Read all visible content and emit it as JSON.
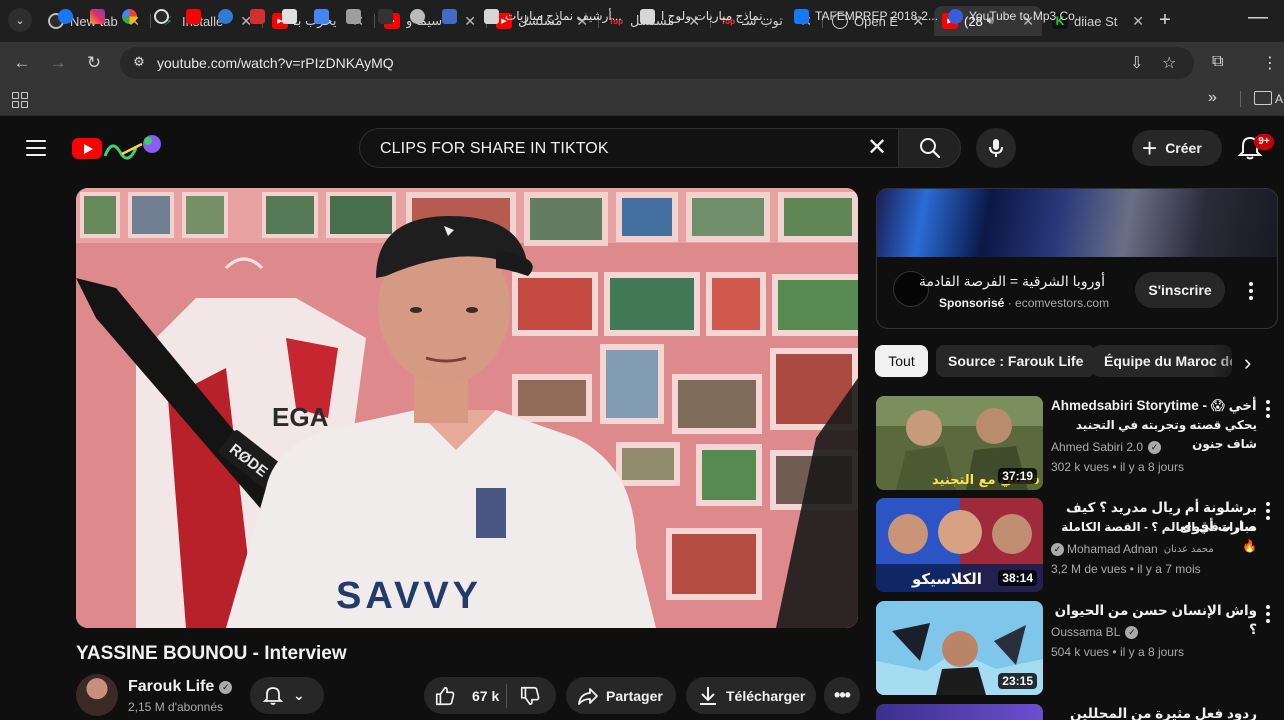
{
  "browser": {
    "tabs": [
      {
        "title": "New tab",
        "favicon": "chrome-icon",
        "color": "#444444"
      },
      {
        "title": "Installe",
        "favicon": "bolt-icon",
        "color": "#1aa260"
      },
      {
        "title": "يخرب بـ",
        "favicon": "youtube-icon",
        "color": "#ff0000"
      },
      {
        "title": "سيما و",
        "favicon": "youtube-icon",
        "color": "#ff0000"
      },
      {
        "title": "مسلسل",
        "favicon": "youtube-icon",
        "color": "#ff0000"
      },
      {
        "title": "مسلسل",
        "favicon": "toptop-icon",
        "color": "#ff0000"
      },
      {
        "title": "توب سـ",
        "favicon": "toptop-icon",
        "color": "#ff0000"
      },
      {
        "title": "Open E",
        "favicon": "openai-icon",
        "color": "#555555"
      },
      {
        "title": "(28",
        "favicon": "youtube-icon",
        "color": "#ff0000"
      },
      {
        "title": "diiae St",
        "favicon": "k-icon",
        "color": "#27c93f"
      }
    ],
    "url": "youtube.com/watch?v=rPIzDNKAyMQ",
    "bookmarks": [
      {
        "label": "أرشيف نماذج مباريات...",
        "color": "#c0c0c0"
      },
      {
        "label": "نماذج مباريات ولوج ا...",
        "color": "#c0c0c0"
      },
      {
        "label": "TAFEMPREP 2018-2...",
        "color": "#1877f2"
      },
      {
        "label": "YouTube to Mp3 Co...",
        "color": "#3b5bdb"
      }
    ]
  },
  "youtube": {
    "search_query": "CLIPS FOR SHARE IN TIKTOK",
    "create_label": "Créer",
    "notifications_badge": "9+",
    "video": {
      "title": "YASSINE BOUNOU - Interview",
      "channel": "Farouk Life",
      "subscribers": "2,15 M d'abonnés",
      "likes": "67 k",
      "share_label": "Partager",
      "download_label": "Télécharger",
      "shirt_text": "SAVVY",
      "jersey_text": "EGA",
      "mic_brand": "RØDE"
    },
    "ad": {
      "title": "أوروبا الشرقية = الفرصة القادمة",
      "sponsored": "Sponsorisé",
      "domain": "ecomvestors.com",
      "subscribe_label": "S'inscrire"
    },
    "chips": [
      "Tout",
      "Source : Farouk Life",
      "Équipe du Maroc de"
    ],
    "recommendations": [
      {
        "title_line1": "Ahmedsabiri Storytime - 😱 أخي",
        "title_line2": "يحكي قصته وتجربته في التجنيد شاف جنون",
        "channel": "Ahmed Sabiri 2.0",
        "views": "302 k vues",
        "age": "il y a 8 jours",
        "duration": "37:19",
        "thumb_text": "قصتي مع التجنيد"
      },
      {
        "title_line1": "برشلونة أم ريال مدريد ؟ كيف صارت أقوى",
        "title_line2": "مباراة في العالم ؟ - القصة الكاملة 🔥",
        "channel": "Mohamad Adnan",
        "channel_ar": "محمد عدنان",
        "views": "3,2 M de vues",
        "age": "il y a 7 mois",
        "duration": "38:14",
        "thumb_text": "الكلاسيكو"
      },
      {
        "title_line1": "واش الإنسان حسن من الحيوان ؟",
        "channel": "Oussama BL",
        "views": "504 k vues",
        "age": "il y a 8 jours",
        "duration": "23:15"
      },
      {
        "title_line1": "ردود فعل مثيرة من المحللين على إقصاء"
      }
    ]
  }
}
